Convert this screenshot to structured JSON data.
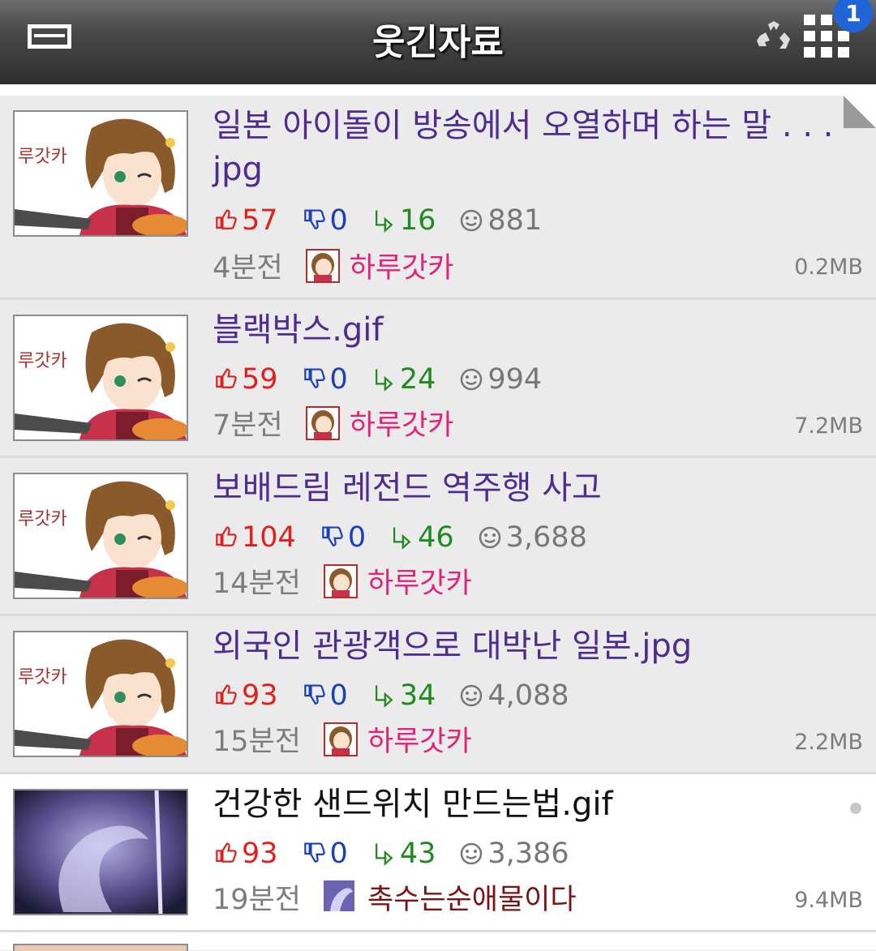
{
  "header": {
    "title": "웃긴자료",
    "notification_count": "1",
    "menu_icon": "menu-icon",
    "refresh_icon": "recycle-icon",
    "apps_icon": "grid-icon"
  },
  "colors": {
    "header_bg": "#3a3a3a",
    "title_read": "#4f2a8f",
    "like": "#e0201d",
    "dislike": "#1a3fbd",
    "share": "#1f8a1f",
    "author": "#e0247a"
  },
  "posts": [
    {
      "title": "일본 아이돌이 방송에서 오열하며 하는 말 . . . jpg",
      "likes": "57",
      "dislikes": "0",
      "shares": "16",
      "views": "881",
      "time": "4분전",
      "author": "하루갓카",
      "size": "0.2MB"
    },
    {
      "title": "블랙박스.gif",
      "likes": "59",
      "dislikes": "0",
      "shares": "24",
      "views": "994",
      "time": "7분전",
      "author": "하루갓카",
      "size": "7.2MB"
    },
    {
      "title": "보배드림 레전드 역주행 사고",
      "likes": "104",
      "dislikes": "0",
      "shares": "46",
      "views": "3,688",
      "time": "14분전",
      "author": "하루갓카",
      "size": ""
    },
    {
      "title": "외국인 관광객으로 대박난 일본.jpg",
      "likes": "93",
      "dislikes": "0",
      "shares": "34",
      "views": "4,088",
      "time": "15분전",
      "author": "하루갓카",
      "size": "2.2MB"
    },
    {
      "title": "건강한 샌드위치 만드는법.gif",
      "likes": "93",
      "dislikes": "0",
      "shares": "43",
      "views": "3,386",
      "time": "19분전",
      "author": "촉수는순애물이다",
      "size": "9.4MB"
    }
  ]
}
